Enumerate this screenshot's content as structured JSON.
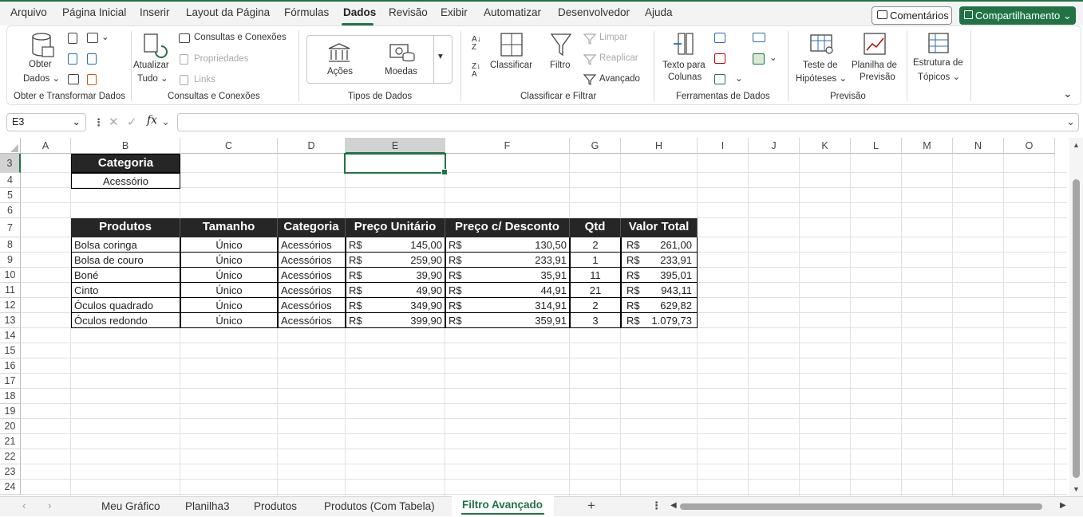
{
  "menu": {
    "tabs": [
      "Arquivo",
      "Página Inicial",
      "Inserir",
      "Layout da Página",
      "Fórmulas",
      "Dados",
      "Revisão",
      "Exibir",
      "Automatizar",
      "Desenvolvedor",
      "Ajuda"
    ],
    "comments": "Comentários",
    "share": "Compartilhamento"
  },
  "ribbon": {
    "get_data_1": "Obter",
    "get_data_2": "Dados",
    "refresh_1": "Atualizar",
    "refresh_2": "Tudo",
    "queries": "Consultas e Conexões",
    "properties": "Propriedades",
    "links": "Links",
    "stocks": "Ações",
    "currencies": "Moedas",
    "sort": "Classificar",
    "filter": "Filtro",
    "clear": "Limpar",
    "reapply": "Reaplicar",
    "advanced": "Avançado",
    "text_to_cols_1": "Texto para",
    "text_to_cols_2": "Colunas",
    "whatif_1": "Teste de",
    "whatif_2": "Hipóteses",
    "forecast_1": "Planilha de",
    "forecast_2": "Previsão",
    "outline_1": "Estrutura de",
    "outline_2": "Tópicos",
    "groups": {
      "g1": "Obter e Transformar Dados",
      "g2": "Consultas e Conexões",
      "g3": "Tipos de Dados",
      "g4": "Classificar e Filtrar",
      "g5": "Ferramentas de Dados",
      "g6": "Previsão"
    }
  },
  "formula": {
    "namebox": "E3",
    "value": ""
  },
  "columns": [
    "A",
    "B",
    "C",
    "D",
    "E",
    "F",
    "G",
    "H",
    "I",
    "J",
    "K",
    "L",
    "M",
    "N",
    "O"
  ],
  "rows": [
    "3",
    "4",
    "5",
    "6",
    "7",
    "8",
    "9",
    "10",
    "11",
    "12",
    "13",
    "14",
    "15",
    "16",
    "17",
    "18",
    "19",
    "20",
    "21",
    "22",
    "23",
    "24"
  ],
  "criteria": {
    "header": "Categoria",
    "value": "Acessório"
  },
  "table": {
    "headers": [
      "Produtos",
      "Tamanho",
      "Categoria",
      "Preço Unitário",
      "Preço c/ Desconto",
      "Qtd",
      "Valor Total"
    ],
    "currency": "R$",
    "rows": [
      {
        "produto": "Bolsa coringa",
        "tamanho": "Único",
        "categoria": "Acessórios",
        "preco": "145,00",
        "desconto": "130,50",
        "qtd": "2",
        "total": "261,00"
      },
      {
        "produto": "Bolsa de couro",
        "tamanho": "Único",
        "categoria": "Acessórios",
        "preco": "259,90",
        "desconto": "233,91",
        "qtd": "1",
        "total": "233,91"
      },
      {
        "produto": "Boné",
        "tamanho": "Único",
        "categoria": "Acessórios",
        "preco": "39,90",
        "desconto": "35,91",
        "qtd": "11",
        "total": "395,01"
      },
      {
        "produto": "Cinto",
        "tamanho": "Único",
        "categoria": "Acessórios",
        "preco": "49,90",
        "desconto": "44,91",
        "qtd": "21",
        "total": "943,11"
      },
      {
        "produto": "Óculos quadrado",
        "tamanho": "Único",
        "categoria": "Acessórios",
        "preco": "349,90",
        "desconto": "314,91",
        "qtd": "2",
        "total": "629,82"
      },
      {
        "produto": "Óculos redondo",
        "tamanho": "Único",
        "categoria": "Acessórios",
        "preco": "399,90",
        "desconto": "359,91",
        "qtd": "3",
        "total": "1.079,73"
      }
    ]
  },
  "sheets": [
    "Meu Gráfico",
    "Planilha3",
    "Produtos",
    "Produtos (Com Tabela)",
    "Filtro Avançado"
  ],
  "active_sheet": "Filtro Avançado",
  "colors": {
    "accent": "#217346",
    "header_fill": "#262626"
  }
}
